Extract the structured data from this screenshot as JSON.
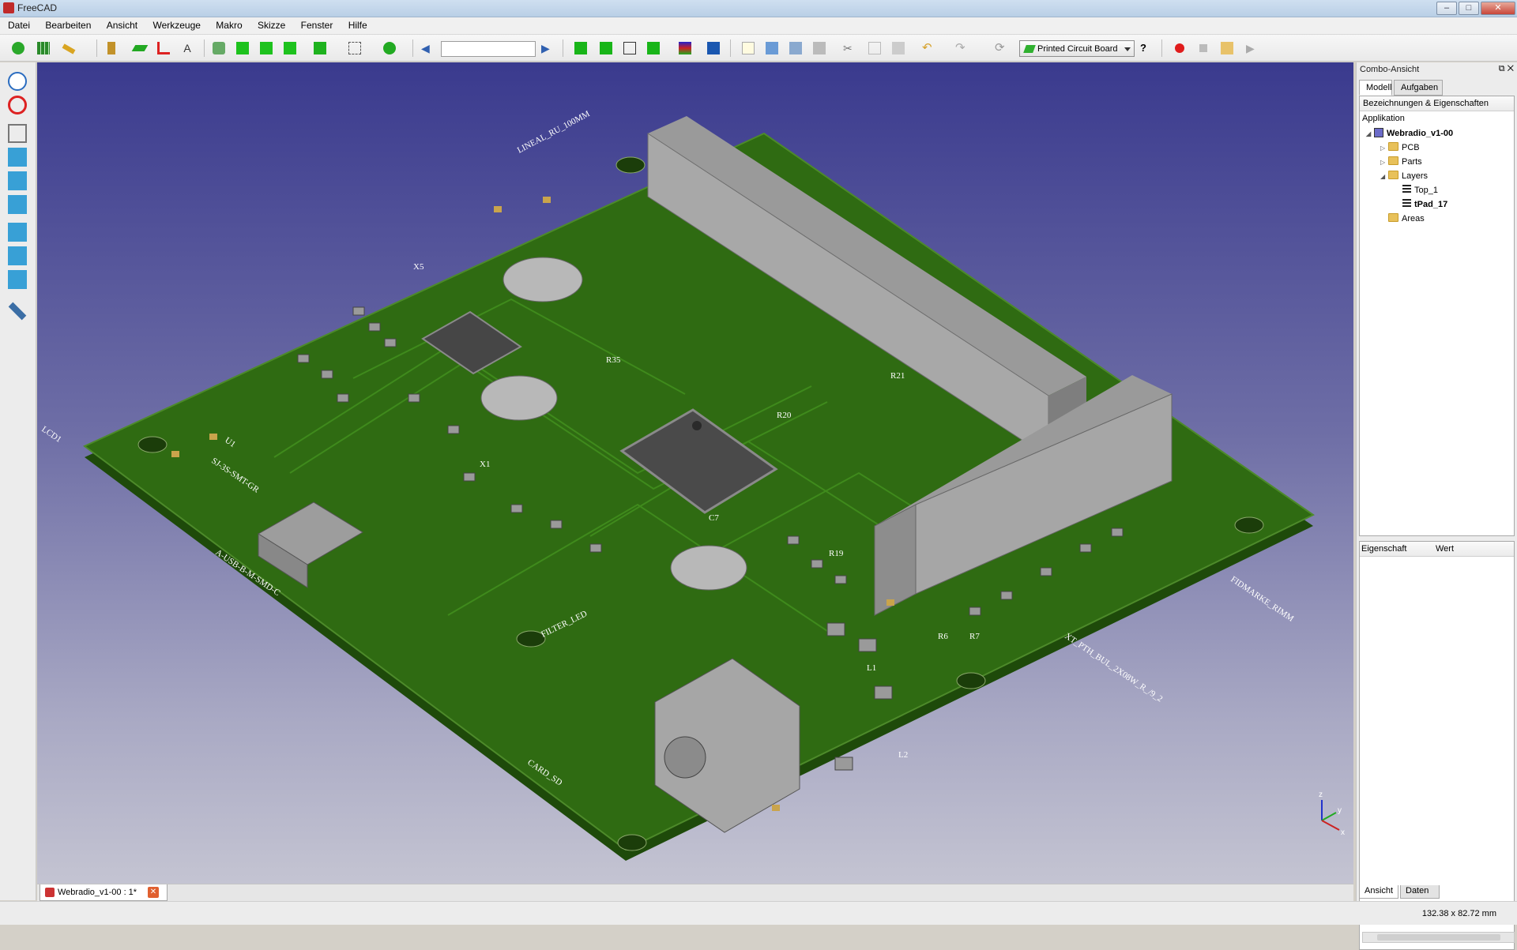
{
  "window": {
    "title": "FreeCAD",
    "controls": [
      "–",
      "□",
      "✕"
    ]
  },
  "menubar": [
    "Datei",
    "Bearbeiten",
    "Ansicht",
    "Werkzeuge",
    "Makro",
    "Skizze",
    "Fenster",
    "Hilfe"
  ],
  "toolbar": {
    "workbench": "Printed Circuit Board",
    "nav_url": "",
    "icons": [
      "new-pcb-icon",
      "table-icon",
      "wrench-icon",
      "part-icon",
      "layer-icon",
      "route-icon",
      "text-icon",
      "snap-icon",
      "box-add-icon",
      "box-sub-icon",
      "box-move-icon",
      "box-icon",
      "select-box-icon",
      "group-icon",
      "back-icon",
      "forward-icon",
      "iso-view-icon",
      "front-view-icon",
      "wire-view-icon",
      "top-view-icon",
      "layers-icon",
      "board-icon",
      "new-file-icon",
      "open-file-icon",
      "save-icon",
      "print-icon",
      "cut-icon",
      "copy-icon",
      "paste-icon",
      "undo-icon",
      "redo-icon",
      "refresh-icon",
      "whatsthis-icon",
      "record-icon",
      "stop-icon",
      "macro-icon",
      "play-icon"
    ]
  },
  "left_toolbar": [
    "zoom-fit-icon",
    "draw-style-icon",
    "axo-view-icon",
    "front-view-icon",
    "top-view-icon",
    "right-view-icon",
    "rear-view-icon",
    "bottom-view-icon",
    "left-view-icon",
    "measure-icon"
  ],
  "combo_view": {
    "header": "Combo-Ansicht",
    "tabs": [
      "Modell",
      "Aufgaben"
    ],
    "active_tab": "Modell",
    "tree_header": "Bezeichnungen & Eigenschaften",
    "tree": [
      {
        "label": "Applikation",
        "level": 0
      },
      {
        "label": "Webradio_v1-00",
        "level": 1,
        "bold": true,
        "expanded": true
      },
      {
        "label": "PCB",
        "level": 2,
        "expanded": false
      },
      {
        "label": "Parts",
        "level": 2,
        "expanded": false
      },
      {
        "label": "Layers",
        "level": 2,
        "expanded": true
      },
      {
        "label": "Top_1",
        "level": 3
      },
      {
        "label": "tPad_17",
        "level": 3,
        "bold": true
      },
      {
        "label": "Areas",
        "level": 2
      }
    ],
    "prop_columns": [
      "Eigenschaft",
      "Wert"
    ],
    "bottom_tabs": [
      "Ansicht",
      "Daten"
    ]
  },
  "document_tab": "Webradio_v1-00 : 1*",
  "status": {
    "dimensions": "132.38 x 82.72 mm"
  },
  "viewport": {
    "silkscreen": [
      "LINEAL_RU_100MM",
      "SJ-3S-SMT-GR",
      "A-USB-B-M-SMD-C",
      "FILTER_LED",
      "CARD_SD",
      "FIDMARKE_RIMM",
      "XT_PTH_BUL_2X08W_R_/9_2",
      "LCD1",
      "U1",
      "R35",
      "C7",
      "R6",
      "R7",
      "R19",
      "R20",
      "R21",
      "L1",
      "L2",
      "X5",
      "X1"
    ],
    "colors": {
      "board": "#2f6b12",
      "pad": "#c9a44c",
      "component": "#a8a8a8",
      "ic": "#474747"
    },
    "axes": [
      "x",
      "y",
      "z"
    ]
  }
}
